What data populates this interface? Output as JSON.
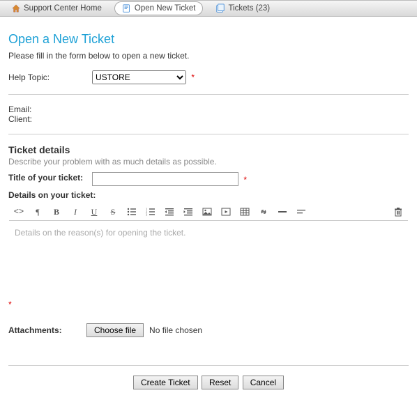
{
  "nav": {
    "home": "Support Center Home",
    "open_new": "Open New Ticket",
    "tickets": "Tickets (23)"
  },
  "page": {
    "title": "Open a New Ticket",
    "intro": "Please fill in the form below to open a new ticket."
  },
  "help_topic": {
    "label": "Help Topic:",
    "selected": "USTORE",
    "options": [
      "USTORE"
    ]
  },
  "contact": {
    "email_label": "Email:",
    "client_label": "Client:"
  },
  "ticket_details": {
    "heading": "Ticket details",
    "subheading": "Describe your problem with as much details as possible.",
    "title_label": "Title of your ticket:",
    "title_value": "",
    "details_label": "Details on your ticket:",
    "details_placeholder": "Details on the reason(s) for opening the ticket."
  },
  "toolbar": {
    "code": "code-view-icon",
    "paragraph": "paragraph-icon",
    "bold": "bold-icon",
    "italic": "italic-icon",
    "underline": "underline-icon",
    "strike": "strike-icon",
    "ul": "unordered-list-icon",
    "ol": "ordered-list-icon",
    "outdent": "outdent-icon",
    "indent": "indent-icon",
    "image": "image-icon",
    "video": "video-icon",
    "table": "table-icon",
    "link": "link-icon",
    "hr": "horizontal-rule-icon",
    "more": "more-icon",
    "trash": "trash-icon"
  },
  "attachments": {
    "label": "Attachments:",
    "button": "Choose file",
    "status": "No file chosen"
  },
  "buttons": {
    "create": "Create Ticket",
    "reset": "Reset",
    "cancel": "Cancel"
  }
}
